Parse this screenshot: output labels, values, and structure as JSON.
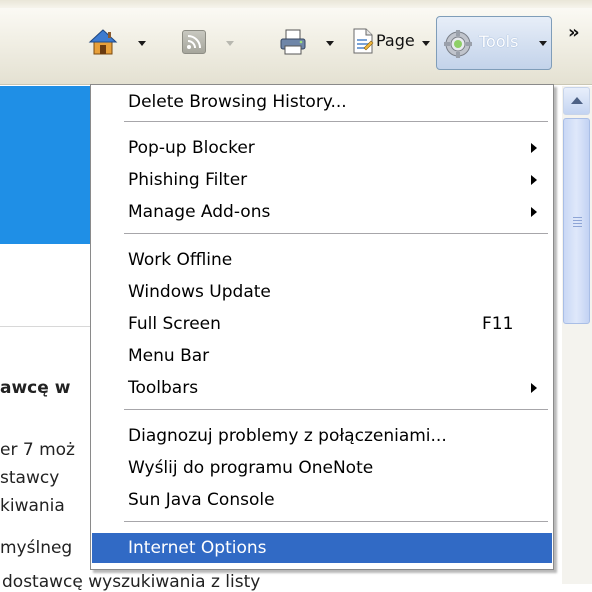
{
  "toolbar": {
    "page_label": "Page",
    "tools_label": "Tools",
    "overflow_label": "»",
    "icons": [
      "home-icon",
      "rss-feed-icon",
      "print-icon",
      "page-icon",
      "gear-icon"
    ]
  },
  "menu": {
    "items": [
      {
        "label": "Delete Browsing History..."
      },
      {
        "label": "Pop-up Blocker",
        "submenu": true
      },
      {
        "label": "Phishing Filter",
        "submenu": true
      },
      {
        "label": "Manage Add-ons",
        "submenu": true
      },
      {
        "label": "Work Offline"
      },
      {
        "label": "Windows Update"
      },
      {
        "label": "Full Screen",
        "shortcut": "F11"
      },
      {
        "label": "Menu Bar"
      },
      {
        "label": "Toolbars",
        "submenu": true
      },
      {
        "label": "Diagnozuj problemy z połączeniami..."
      },
      {
        "label": "Wyślij do programu OneNote"
      },
      {
        "label": "Sun Java Console"
      },
      {
        "label": "Internet Options",
        "highlighted": true
      }
    ]
  },
  "background_page": {
    "line1": "awcę w",
    "line2": "er 7 moż",
    "line3": "stawcy",
    "line4": "kiwania",
    "line5": "myślneg",
    "line6": "dostawcę wyszukiwania z listy"
  },
  "colors": {
    "highlight": "#316ac5",
    "banner": "#1f8fe6"
  }
}
